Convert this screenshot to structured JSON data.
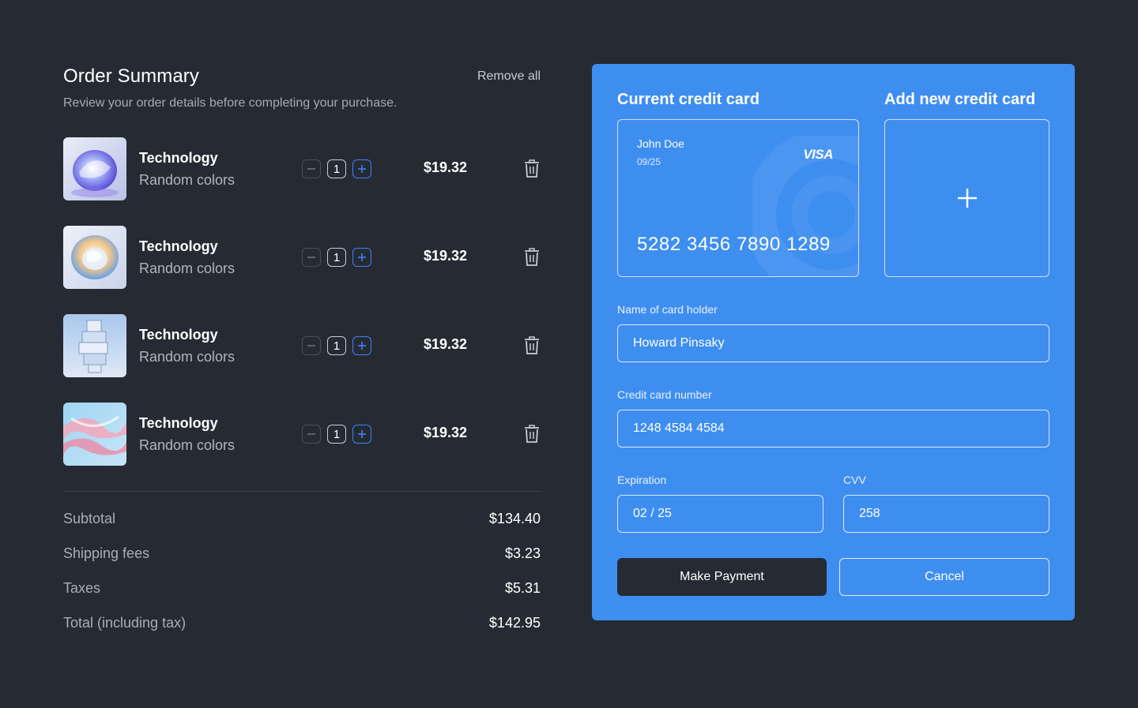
{
  "summary": {
    "title": "Order Summary",
    "subtitle": "Review your order details before completing your purchase.",
    "remove_all": "Remove all",
    "items": [
      {
        "name": "Technology",
        "variant": "Random colors",
        "qty": "1",
        "price": "$19.32"
      },
      {
        "name": "Technology",
        "variant": "Random colors",
        "qty": "1",
        "price": "$19.32"
      },
      {
        "name": "Technology",
        "variant": "Random colors",
        "qty": "1",
        "price": "$19.32"
      },
      {
        "name": "Technology",
        "variant": "Random colors",
        "qty": "1",
        "price": "$19.32"
      }
    ],
    "totals": [
      {
        "label": "Subtotal",
        "value": "$134.40"
      },
      {
        "label": "Shipping fees",
        "value": "$3.23"
      },
      {
        "label": "Taxes",
        "value": "$5.31"
      },
      {
        "label": "Total (including tax)",
        "value": "$142.95"
      }
    ]
  },
  "payment": {
    "current_card_title": "Current credit card",
    "add_card_title": "Add new credit card",
    "card": {
      "holder": "John Doe",
      "expiry": "09/25",
      "brand": "VISA",
      "number": "5282 3456 7890 1289"
    },
    "name_label": "Name of card holder",
    "name_value": "Howard Pinsaky",
    "number_label": "Credit card number",
    "number_value": "1248 4584 4584",
    "expiration_label": "Expiration",
    "expiration_value": "02 / 25",
    "cvv_label": "CVV",
    "cvv_value": "258",
    "pay_button": "Make Payment",
    "cancel_button": "Cancel"
  },
  "icons": {
    "minus": "minus-icon",
    "plus": "plus-icon",
    "trash": "trash-icon",
    "add": "plus-icon"
  },
  "colors": {
    "background": "#262b33",
    "panel": "#3e8ef0",
    "accent": "#3b82f6"
  }
}
